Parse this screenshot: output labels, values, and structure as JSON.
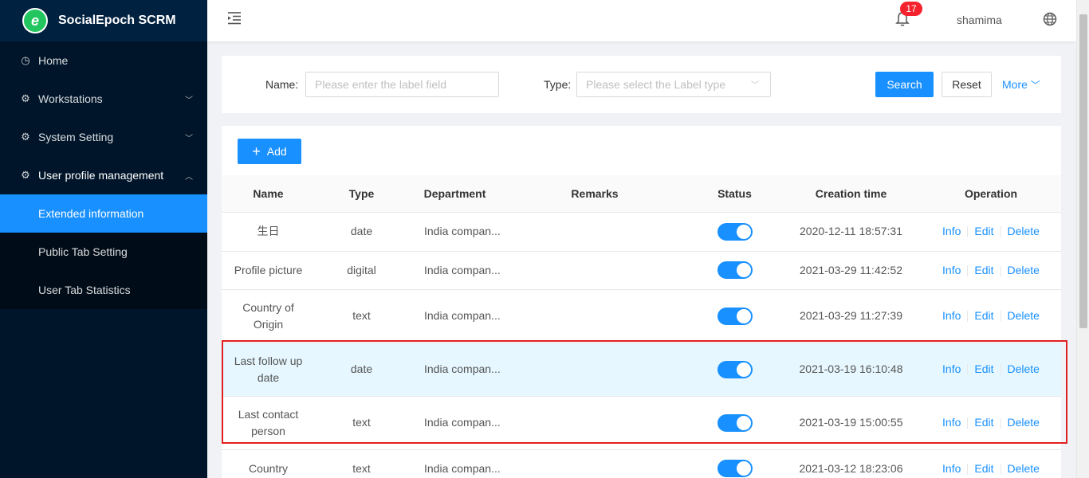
{
  "app": {
    "title": "SocialEpoch SCRM",
    "logo_letter": "e"
  },
  "sidebar": {
    "items": [
      {
        "label": "Home",
        "icon": "clock-icon"
      },
      {
        "label": "Workstations",
        "icon": "gear-icon"
      },
      {
        "label": "System Setting",
        "icon": "gear-icon"
      },
      {
        "label": "User profile management",
        "icon": "gear-icon"
      }
    ],
    "submenu": [
      {
        "label": "Extended information",
        "selected": true
      },
      {
        "label": "Public Tab Setting",
        "selected": false
      },
      {
        "label": "User Tab Statistics",
        "selected": false
      }
    ]
  },
  "header": {
    "notifications": "17",
    "username": "shamima"
  },
  "search": {
    "name_label": "Name:",
    "name_placeholder": "Please enter the label field",
    "type_label": "Type:",
    "type_placeholder": "Please select the Label type",
    "search_button": "Search",
    "reset_button": "Reset",
    "more_link": "More"
  },
  "table": {
    "add_button": "Add",
    "columns": [
      "Name",
      "Type",
      "Department",
      "Remarks",
      "Status",
      "Creation time",
      "Operation"
    ],
    "operations": [
      "Info",
      "Edit",
      "Delete"
    ],
    "rows": [
      {
        "name": "生日",
        "type": "date",
        "department": "India compan...",
        "remarks": "",
        "status": true,
        "created": "2020-12-11 18:57:31"
      },
      {
        "name": "Profile picture",
        "type": "digital",
        "department": "India compan...",
        "remarks": "",
        "status": true,
        "created": "2021-03-29 11:42:52"
      },
      {
        "name": "Country of Origin",
        "type": "text",
        "department": "India compan...",
        "remarks": "",
        "status": true,
        "created": "2021-03-29 11:27:39"
      },
      {
        "name": "Last follow up date",
        "type": "date",
        "department": "India compan...",
        "remarks": "",
        "status": true,
        "created": "2021-03-19 16:10:48"
      },
      {
        "name": "Last contact person",
        "type": "text",
        "department": "India compan...",
        "remarks": "",
        "status": true,
        "created": "2021-03-19 15:00:55"
      },
      {
        "name": "Country",
        "type": "text",
        "department": "India compan...",
        "remarks": "",
        "status": true,
        "created": "2021-03-12 18:23:06"
      }
    ]
  },
  "colors": {
    "primary": "#1890ff",
    "sidebar": "#001529",
    "highlight": "#e02020"
  }
}
